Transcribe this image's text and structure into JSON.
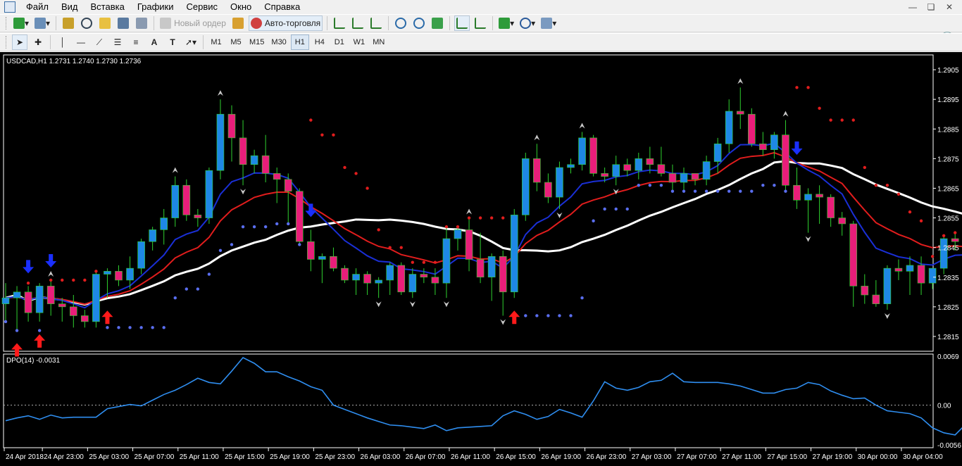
{
  "menu": {
    "items": [
      "Файл",
      "Вид",
      "Вставка",
      "Графики",
      "Сервис",
      "Окно",
      "Справка"
    ]
  },
  "toolbar": {
    "new_order_label": "Новый ордер",
    "autotrading_label": "Авто-торговля",
    "timeframes": [
      "M1",
      "M5",
      "M15",
      "M30",
      "H1",
      "H4",
      "D1",
      "W1",
      "MN"
    ],
    "active_timeframe": "H1"
  },
  "chart": {
    "symbol_info": "USDCAD,H1  1.2731 1.2740 1.2730 1.2736",
    "price_ticks": [
      "1.2905",
      "1.2895",
      "1.2885",
      "1.2875",
      "1.2865",
      "1.2855",
      "1.2845",
      "1.2835",
      "1.2825",
      "1.2815"
    ],
    "time_ticks": [
      "24 Apr 2018",
      "24 Apr 23:00",
      "25 Apr 03:00",
      "25 Apr 07:00",
      "25 Apr 11:00",
      "25 Apr 15:00",
      "25 Apr 19:00",
      "25 Apr 23:00",
      "26 Apr 03:00",
      "26 Apr 07:00",
      "26 Apr 11:00",
      "26 Apr 15:00",
      "26 Apr 19:00",
      "26 Apr 23:00",
      "27 Apr 03:00",
      "27 Apr 07:00",
      "27 Apr 11:00",
      "27 Apr 15:00",
      "27 Apr 19:00",
      "30 Apr 00:00",
      "30 Apr 04:00"
    ],
    "indicator_label": "DPO(14) -0.0031",
    "indicator_ticks": [
      "0.0069",
      "0.00",
      "-0.0056"
    ]
  },
  "chart_data": {
    "type": "candlestick",
    "symbol": "USDCAD",
    "timeframe": "H1",
    "ylim": [
      1.281,
      1.291
    ],
    "bull_color": "#1e88e5",
    "bear_color": "#e91e7a",
    "candles": [
      [
        1.2826,
        1.2833,
        1.282,
        1.2828
      ],
      [
        1.2828,
        1.2832,
        1.2817,
        1.283
      ],
      [
        1.283,
        1.2832,
        1.282,
        1.2823
      ],
      [
        1.2823,
        1.2833,
        1.282,
        1.2832
      ],
      [
        1.2832,
        1.2834,
        1.2822,
        1.2826
      ],
      [
        1.2826,
        1.2828,
        1.282,
        1.2825
      ],
      [
        1.2825,
        1.2829,
        1.2818,
        1.2822
      ],
      [
        1.2822,
        1.2824,
        1.2818,
        1.282
      ],
      [
        1.282,
        1.2837,
        1.2818,
        1.2836
      ],
      [
        1.2836,
        1.2838,
        1.2828,
        1.2837
      ],
      [
        1.2837,
        1.2839,
        1.2832,
        1.2834
      ],
      [
        1.2834,
        1.2842,
        1.2831,
        1.2838
      ],
      [
        1.2838,
        1.2848,
        1.2836,
        1.2847
      ],
      [
        1.2847,
        1.2852,
        1.2844,
        1.2851
      ],
      [
        1.2851,
        1.2858,
        1.2846,
        1.2855
      ],
      [
        1.2855,
        1.2869,
        1.2852,
        1.2866
      ],
      [
        1.2866,
        1.2868,
        1.2854,
        1.2856
      ],
      [
        1.2856,
        1.2858,
        1.2852,
        1.2855
      ],
      [
        1.2855,
        1.2872,
        1.2853,
        1.2871
      ],
      [
        1.2871,
        1.2895,
        1.2868,
        1.289
      ],
      [
        1.289,
        1.2893,
        1.2874,
        1.2882
      ],
      [
        1.2882,
        1.2888,
        1.2866,
        1.2873
      ],
      [
        1.2873,
        1.2878,
        1.287,
        1.2876
      ],
      [
        1.2876,
        1.2883,
        1.2867,
        1.287
      ],
      [
        1.287,
        1.2872,
        1.286,
        1.2868
      ],
      [
        1.2868,
        1.287,
        1.2853,
        1.2864
      ],
      [
        1.2864,
        1.2865,
        1.2846,
        1.2847
      ],
      [
        1.2847,
        1.2851,
        1.2837,
        1.2841
      ],
      [
        1.2841,
        1.2843,
        1.2833,
        1.2842
      ],
      [
        1.2842,
        1.2845,
        1.2837,
        1.2838
      ],
      [
        1.2838,
        1.2839,
        1.2833,
        1.2834
      ],
      [
        1.2834,
        1.2838,
        1.2829,
        1.2836
      ],
      [
        1.2836,
        1.2837,
        1.2829,
        1.2833
      ],
      [
        1.2833,
        1.2835,
        1.2828,
        1.2834
      ],
      [
        1.2834,
        1.284,
        1.2829,
        1.2839
      ],
      [
        1.2839,
        1.284,
        1.2829,
        1.283
      ],
      [
        1.283,
        1.2838,
        1.2828,
        1.2836
      ],
      [
        1.2836,
        1.2838,
        1.2833,
        1.2835
      ],
      [
        1.2835,
        1.2838,
        1.2829,
        1.2833
      ],
      [
        1.2833,
        1.2852,
        1.2828,
        1.2848
      ],
      [
        1.2848,
        1.2852,
        1.2844,
        1.2851
      ],
      [
        1.2851,
        1.2855,
        1.2837,
        1.2841
      ],
      [
        1.2841,
        1.285,
        1.2833,
        1.2835
      ],
      [
        1.2835,
        1.2843,
        1.2827,
        1.2842
      ],
      [
        1.2842,
        1.2844,
        1.2822,
        1.283
      ],
      [
        1.283,
        1.2858,
        1.2828,
        1.2856
      ],
      [
        1.2856,
        1.2877,
        1.2854,
        1.2875
      ],
      [
        1.2875,
        1.288,
        1.2864,
        1.2867
      ],
      [
        1.2867,
        1.287,
        1.286,
        1.2862
      ],
      [
        1.2862,
        1.2874,
        1.2858,
        1.2872
      ],
      [
        1.2872,
        1.2875,
        1.287,
        1.2873
      ],
      [
        1.2873,
        1.2884,
        1.2871,
        1.2882
      ],
      [
        1.2882,
        1.2883,
        1.2869,
        1.287
      ],
      [
        1.287,
        1.2872,
        1.2867,
        1.2869
      ],
      [
        1.2869,
        1.2876,
        1.2866,
        1.2873
      ],
      [
        1.2873,
        1.2875,
        1.2869,
        1.2871
      ],
      [
        1.2871,
        1.2877,
        1.2868,
        1.2875
      ],
      [
        1.2875,
        1.2879,
        1.287,
        1.2873
      ],
      [
        1.2873,
        1.2879,
        1.2869,
        1.287
      ],
      [
        1.287,
        1.2873,
        1.2864,
        1.2867
      ],
      [
        1.2867,
        1.2872,
        1.2864,
        1.287
      ],
      [
        1.287,
        1.287,
        1.2866,
        1.2868
      ],
      [
        1.2868,
        1.2876,
        1.2866,
        1.2874
      ],
      [
        1.2874,
        1.2882,
        1.287,
        1.288
      ],
      [
        1.288,
        1.2895,
        1.2877,
        1.2891
      ],
      [
        1.2891,
        1.2899,
        1.2885,
        1.289
      ],
      [
        1.289,
        1.2892,
        1.2879,
        1.288
      ],
      [
        1.288,
        1.2884,
        1.2876,
        1.2878
      ],
      [
        1.2878,
        1.2884,
        1.2875,
        1.2883
      ],
      [
        1.2883,
        1.2888,
        1.2864,
        1.2866
      ],
      [
        1.2866,
        1.2872,
        1.2858,
        1.2861
      ],
      [
        1.2861,
        1.2865,
        1.285,
        1.2863
      ],
      [
        1.2863,
        1.2866,
        1.2853,
        1.2862
      ],
      [
        1.2862,
        1.2863,
        1.2852,
        1.2855
      ],
      [
        1.2855,
        1.2857,
        1.2849,
        1.2853
      ],
      [
        1.2853,
        1.2854,
        1.2825,
        1.2832
      ],
      [
        1.2832,
        1.2836,
        1.2826,
        1.2829
      ],
      [
        1.2829,
        1.2834,
        1.2825,
        1.2826
      ],
      [
        1.2826,
        1.2839,
        1.2824,
        1.2838
      ],
      [
        1.2838,
        1.2841,
        1.2834,
        1.2837
      ],
      [
        1.2837,
        1.2842,
        1.2829,
        1.2839
      ],
      [
        1.2839,
        1.2842,
        1.2829,
        1.2833
      ],
      [
        1.2833,
        1.2838,
        1.2831,
        1.2838
      ],
      [
        1.2838,
        1.2849,
        1.2836,
        1.2848
      ],
      [
        1.2848,
        1.285,
        1.2844,
        1.2847
      ],
      [
        1.2847,
        1.2849,
        1.2841,
        1.2843
      ]
    ],
    "indicator": {
      "name": "DPO(14)",
      "ylim": [
        -0.006,
        0.0072
      ],
      "values": [
        -0.0022,
        -0.0018,
        -0.0015,
        -0.002,
        -0.0014,
        -0.0018,
        -0.0017,
        -0.0017,
        -0.0017,
        -0.0005,
        -0.0002,
        0.0001,
        -0.0001,
        0.0007,
        0.0015,
        0.0021,
        0.0029,
        0.0038,
        0.0032,
        0.003,
        0.0048,
        0.0067,
        0.0059,
        0.0047,
        0.0047,
        0.004,
        0.0034,
        0.0026,
        0.0021,
        0.0,
        -0.0006,
        -0.0012,
        -0.0018,
        -0.0023,
        -0.0028,
        -0.0029,
        -0.0031,
        -0.0033,
        -0.0028,
        -0.0036,
        -0.0032,
        -0.0031,
        -0.003,
        -0.0029,
        -0.0015,
        -0.0008,
        -0.0013,
        -0.002,
        -0.0016,
        -0.0006,
        -0.0011,
        -0.0017,
        0.0006,
        0.0033,
        0.0024,
        0.0021,
        0.0025,
        0.0033,
        0.0035,
        0.0045,
        0.0033,
        0.0032,
        0.0032,
        0.0032,
        0.003,
        0.0027,
        0.0022,
        0.0017,
        0.0017,
        0.0022,
        0.0024,
        0.0032,
        0.0029,
        0.002,
        0.0014,
        0.0009,
        0.001,
        0.0,
        -0.0008,
        -0.001,
        -0.0012,
        -0.0018,
        -0.0032,
        -0.0039,
        -0.0042,
        -0.0026,
        -0.003,
        -0.0026,
        -0.0025,
        -0.0016,
        -0.0013,
        -0.0013
      ]
    }
  }
}
